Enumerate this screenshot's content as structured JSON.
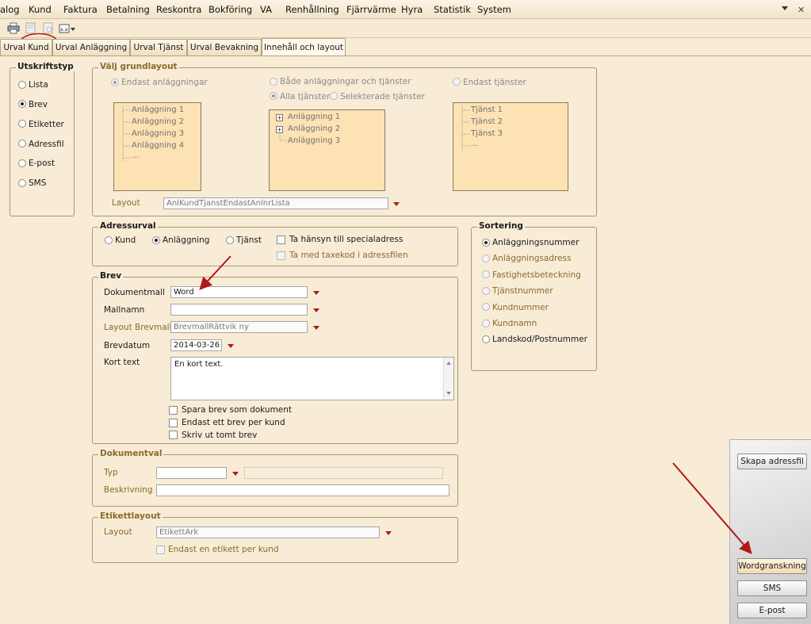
{
  "menu": [
    "alog",
    "Kund",
    "Faktura",
    "Betalning",
    "Reskontra",
    "Bokföring",
    "VA",
    "Renhållning",
    "Fjärrvärme",
    "Hyra",
    "Statistik",
    "System"
  ],
  "tabs": [
    "Urval Kund",
    "Urval Anläggning",
    "Urval Tjänst",
    "Urval Bevakning",
    "Innehåll och layout"
  ],
  "utskriftstyp": {
    "title": "Utskriftstyp",
    "options": [
      "Lista",
      "Brev",
      "Etiketter",
      "Adressfil",
      "E-post",
      "SMS"
    ],
    "selected": "Brev"
  },
  "grundlayout": {
    "title": "Välj grundlayout",
    "opt1": "Endast anläggningar",
    "opt2": "Både anläggningar och tjänster",
    "opt2a": "Alla tjänster",
    "opt2b": "Selekterade tjänster",
    "opt3": "Endast tjänster",
    "tree1": [
      "Anläggning 1",
      "Anläggning 2",
      "Anläggning 3",
      "Anläggning 4",
      "..."
    ],
    "tree2": [
      "Anläggning 1",
      "Anläggning 2",
      "Anläggning 3"
    ],
    "tree3": [
      "Tjänst 1",
      "Tjänst 2",
      "Tjänst 3",
      "..."
    ],
    "layout_label": "Layout",
    "layout_value": "AnlKundTjanstEndastAnlnrLista"
  },
  "adressurval": {
    "title": "Adressurval",
    "kund": "Kund",
    "anlaggning": "Anläggning",
    "tjanst": "Tjänst",
    "special": "Ta hänsyn till specialadress",
    "taxekod": "Ta med taxekod i adressfilen"
  },
  "sortering": {
    "title": "Sortering",
    "options": [
      "Anläggningsnummer",
      "Anläggningsadress",
      "Fastighetsbeteckning",
      "Tjänstnummer",
      "Kundnummer",
      "Kundnamn",
      "Landskod/Postnummer"
    ]
  },
  "brev": {
    "title": "Brev",
    "dokumentmall_label": "Dokumentmall",
    "dokumentmall_value": "Word",
    "mallnamn_label": "Mallnamn",
    "mallnamn_value": "",
    "layoutbrevmall_label": "Layout Brevmall",
    "layoutbrevmall_value": "BrevmallRättvik ny",
    "brevdatum_label": "Brevdatum",
    "brevdatum_value": "2014-03-26",
    "korttext_label": "Kort text",
    "korttext_value": "En kort text.",
    "spara": "Spara brev som dokument",
    "endast_ett": "Endast ett brev per kund",
    "skriv_tomt": "Skriv ut tomt brev"
  },
  "dokumentval": {
    "title": "Dokumentval",
    "typ_label": "Typ",
    "beskrivning_label": "Beskrivning"
  },
  "etikettlayout": {
    "title": "Etikettlayout",
    "layout_label": "Layout",
    "layout_value": "EtikettArk",
    "endast_en": "Endast en etikett per kund"
  },
  "buttons": {
    "skapa": "Skapa adressfil",
    "word": "Wordgranskning",
    "sms": "SMS",
    "epost": "E-post"
  },
  "colors": {
    "accent_arrow": "#b01818",
    "tree_bg": "#fde2b4",
    "panel_bg": "#f8ecd6"
  }
}
